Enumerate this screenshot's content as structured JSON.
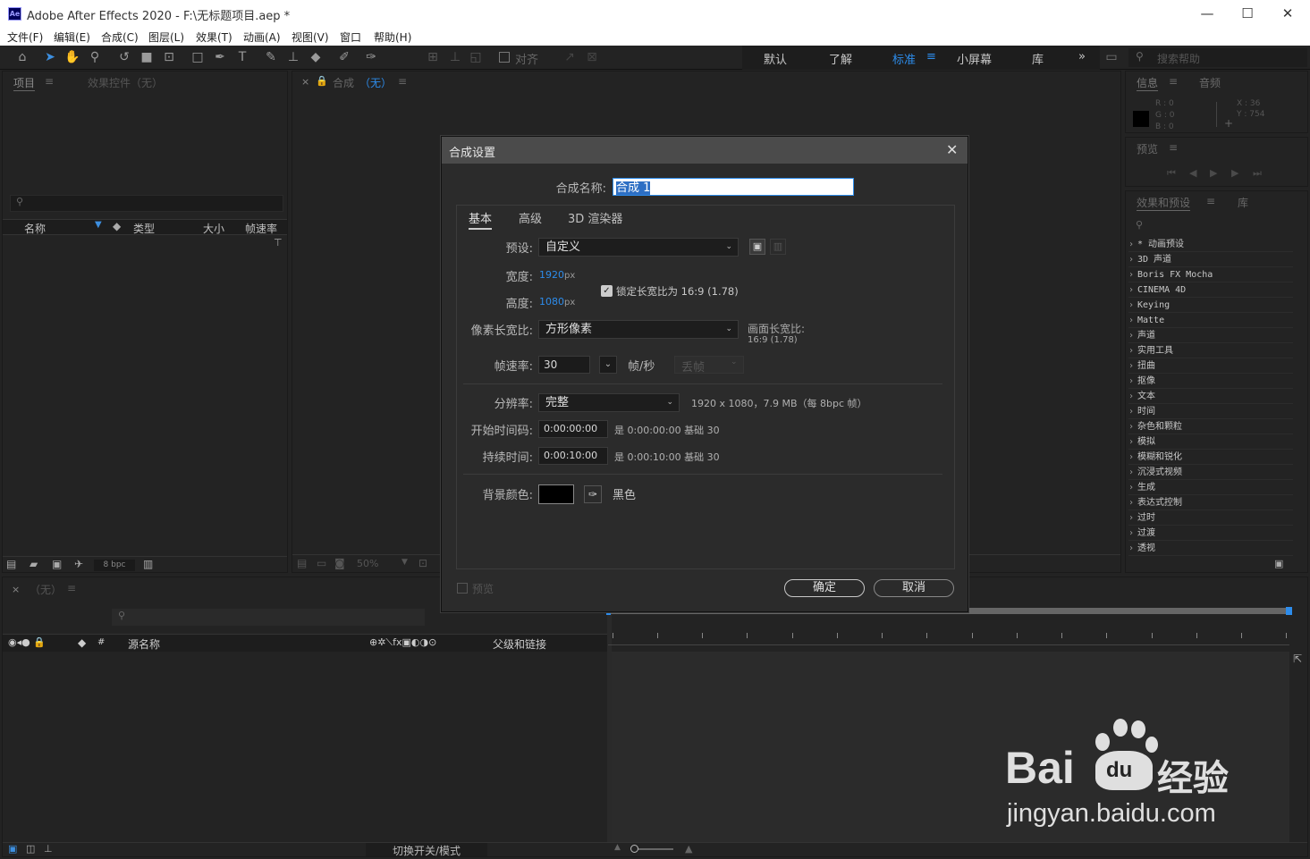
{
  "window": {
    "title": "Adobe After Effects 2020 - F:\\无标题项目.aep *",
    "logo": "Ae",
    "minimize": "—",
    "maximize": "☐",
    "close": "✕"
  },
  "menu": [
    "文件(F)",
    "编辑(E)",
    "合成(C)",
    "图层(L)",
    "效果(T)",
    "动画(A)",
    "视图(V)",
    "窗口",
    "帮助(H)"
  ],
  "toolbar": {
    "snap_label": "对齐",
    "workspaces": [
      "默认",
      "了解",
      "标准",
      "小屏幕",
      "库"
    ],
    "active_workspace": "标准",
    "more": "»",
    "search_placeholder": "搜索帮助"
  },
  "project_panel": {
    "tab_project": "项目",
    "tab_effects": "效果控件（无）",
    "columns": [
      "名称",
      "类型",
      "大小",
      "帧速率"
    ],
    "bpc": "8 bpc"
  },
  "comp_panel": {
    "tab_prefix": "合成",
    "tab_name": "（无）",
    "zoom": "50%"
  },
  "info_panel": {
    "tab_info": "信息",
    "tab_audio": "音频",
    "r": "R : 0",
    "g": "G : 0",
    "b": "B : 0",
    "x": "X : 36",
    "y": "Y : 754"
  },
  "preview_panel": {
    "title": "预览"
  },
  "effects_panel": {
    "tab_effects": "效果和预设",
    "tab_library": "库",
    "items": [
      "* 动画预设",
      "3D 声道",
      "Boris FX Mocha",
      "CINEMA 4D",
      "Keying",
      "Matte",
      "声道",
      "实用工具",
      "扭曲",
      "抠像",
      "文本",
      "时间",
      "杂色和颗粒",
      "模拟",
      "模糊和锐化",
      "沉浸式视频",
      "生成",
      "表达式控制",
      "过时",
      "过渡",
      "透视"
    ]
  },
  "timeline": {
    "tab": "（无）",
    "col_source": "源名称",
    "col_parent": "父级和链接",
    "toggle_label": "切换开关/模式"
  },
  "dialog": {
    "title": "合成设置",
    "name_label": "合成名称:",
    "name_value": "合成 1",
    "tabs": [
      "基本",
      "高级",
      "3D 渲染器"
    ],
    "preset_label": "预设:",
    "preset_value": "自定义",
    "width_label": "宽度:",
    "width_value": "1920",
    "height_label": "高度:",
    "height_value": "1080",
    "unit_px": "px",
    "lock_label": "锁定长宽比为 16:9 (1.78)",
    "pixel_aspect_label": "像素长宽比:",
    "pixel_aspect_value": "方形像素",
    "frame_aspect_label": "画面长宽比:",
    "frame_aspect_value": "16:9 (1.78)",
    "fps_label": "帧速率:",
    "fps_value": "30",
    "fps_unit": "帧/秒",
    "drop_frame": "丢帧",
    "resolution_label": "分辨率:",
    "resolution_value": "完整",
    "resolution_info": "1920 x 1080，7.9 MB（每 8bpc 帧）",
    "start_tc_label": "开始时间码:",
    "start_tc_value": "0:00:00:00",
    "start_tc_info": "是 0:00:00:00  基础 30",
    "duration_label": "持续时间:",
    "duration_value": "0:00:10:00",
    "duration_info": "是 0:00:10:00  基础 30",
    "bg_label": "背景颜色:",
    "bg_name": "黑色",
    "bg_color": "#000000",
    "preview_label": "预览",
    "ok_label": "确定",
    "cancel_label": "取消"
  },
  "watermark": {
    "brand": "Bai",
    "brand_suffix": "du",
    "cn": "经验",
    "url": "jingyan.baidu.com"
  }
}
